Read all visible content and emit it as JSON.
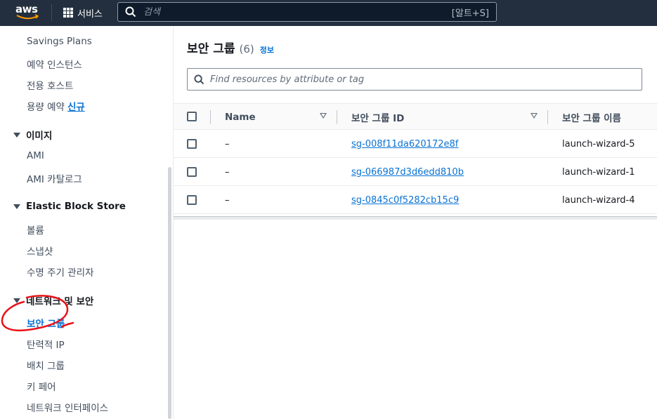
{
  "topbar": {
    "logo_text": "aws",
    "services_label": "서비스",
    "search_placeholder": "검색",
    "search_shortcut": "[알트+S]"
  },
  "sidebar": {
    "items_top": [
      {
        "label": "Savings Plans"
      },
      {
        "label": "예약 인스턴스"
      },
      {
        "label": "전용 호스트"
      },
      {
        "label": "용량 예약",
        "badge": "신규"
      }
    ],
    "sections": [
      {
        "title": "이미지",
        "items": [
          "AMI",
          "AMI 카탈로그"
        ]
      },
      {
        "title": "Elastic Block Store",
        "items": [
          "볼륨",
          "스냅샷",
          "수명 주기 관리자"
        ]
      },
      {
        "title": "네트워크 및 보안",
        "items": [
          "보안 그룹",
          "탄력적 IP",
          "배치 그룹",
          "키 페어",
          "네트워크 인터페이스"
        ]
      }
    ],
    "active_item": "보안 그룹"
  },
  "main": {
    "title": "보안 그룹",
    "count": "(6)",
    "info_link": "정보",
    "filter_placeholder": "Find resources by attribute or tag",
    "columns": [
      "Name",
      "보안 그룹 ID",
      "보안 그룹 이름"
    ],
    "rows": [
      {
        "name": "–",
        "id": "sg-008f11da620172e8f",
        "group_name": "launch-wizard-5"
      },
      {
        "name": "–",
        "id": "sg-066987d3d6edd810b",
        "group_name": "launch-wizard-1"
      },
      {
        "name": "–",
        "id": "sg-0845c0f5282cb15c9",
        "group_name": "launch-wizard-4"
      }
    ]
  },
  "colors": {
    "topbar_bg": "#232f3e",
    "link": "#0972d3",
    "annotation": "#e8121a"
  }
}
